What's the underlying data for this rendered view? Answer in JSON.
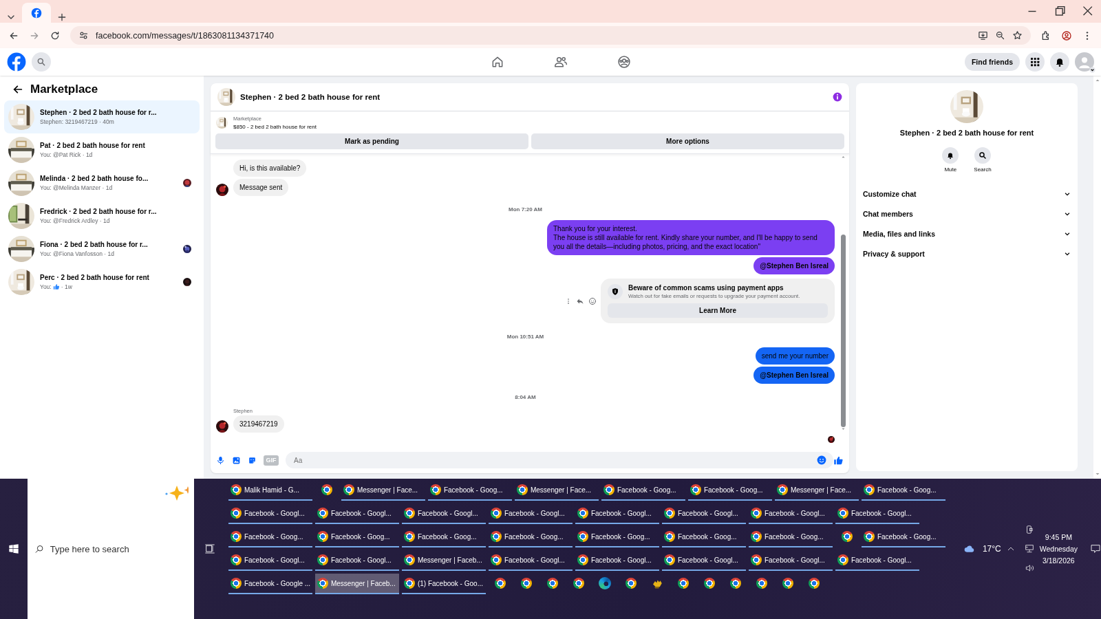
{
  "browser": {
    "url": "facebook.com/messages/t/1863081134371740"
  },
  "header": {
    "find_friends": "Find friends"
  },
  "sidebar": {
    "title": "Marketplace",
    "conversations": [
      {
        "name": "Stephen · 2 bed 2 bath house for r...",
        "preview": "Stephen: 3219467219 · 40m",
        "selected": true,
        "seen_avatar": false,
        "like_icon": false
      },
      {
        "name": "Pat · 2 bed 2 bath house for rent",
        "preview": "You: @Pat Rick · 1d",
        "selected": false,
        "seen_avatar": false,
        "like_icon": false
      },
      {
        "name": "Melinda · 2 bed 2 bath house fo...",
        "preview": "You: @Melinda Manzer · 1d",
        "selected": false,
        "seen_avatar": true,
        "like_icon": false
      },
      {
        "name": "Fredrick · 2 bed 2 bath house for r...",
        "preview": "You: @Fredrick Ardley · 1d",
        "selected": false,
        "seen_avatar": false,
        "like_icon": false
      },
      {
        "name": "Fiona · 2 bed 2 bath house for r...",
        "preview": "You: @Fiona Vanfosson · 1d",
        "selected": false,
        "seen_avatar": true,
        "like_icon": false
      },
      {
        "name": "Perc · 2 bed 2 bath house for rent",
        "preview": "You:",
        "preview_after": "· 1w",
        "selected": false,
        "seen_avatar": true,
        "like_icon": true
      }
    ]
  },
  "chat": {
    "title": "Stephen · 2 bed 2 bath house for rent",
    "listing": {
      "label": "Marketplace",
      "title": "$850 - 2 bed 2 bath house for rent"
    },
    "actions": [
      "Mark as pending",
      "More options"
    ],
    "messages": [
      {
        "kind": "incoming",
        "text": "Hi, is this available?",
        "avatar": false
      },
      {
        "kind": "incoming",
        "text": "Message sent",
        "avatar": true
      },
      {
        "kind": "time",
        "text": "Mon 7:20 AM"
      },
      {
        "kind": "outgoing",
        "text": "Thank you for your interest.\nThe house is still available for rent. Kindly share your number, and I'll be happy to send you all the details—including photos, pricing, and the exact location\"",
        "color": "#7b3ff2",
        "bold": false
      },
      {
        "kind": "outgoing",
        "text": "@Stephen Ben Isreal",
        "color": "#7b3ff2",
        "bold": true
      },
      {
        "kind": "notice",
        "title": "Beware of common scams using payment apps",
        "body": "Watch out for fake emails or requests to upgrade your payment account.",
        "button": "Learn More"
      },
      {
        "kind": "time",
        "text": "Mon 10:51 AM"
      },
      {
        "kind": "outgoing",
        "text": "send me your number",
        "color": "#1465f4",
        "bold": false
      },
      {
        "kind": "outgoing",
        "text": "@Stephen Ben Isreal",
        "color": "#1465f4",
        "bold": true
      },
      {
        "kind": "time",
        "text": "8:04 AM"
      },
      {
        "kind": "incoming",
        "sender": "Stephen",
        "text": "3219467219",
        "avatar": true
      },
      {
        "kind": "seen"
      }
    ],
    "composer": {
      "gif": "GIF",
      "placeholder": "Aa"
    }
  },
  "details": {
    "title": "Stephen · 2 bed 2 bath house for rent",
    "actions": [
      {
        "kind": "mute",
        "label": "Mute"
      },
      {
        "kind": "search",
        "label": "Search"
      }
    ],
    "sections": [
      {
        "label": "Customize chat",
        "expanded": false
      },
      {
        "label": "Chat members",
        "expanded": false
      },
      {
        "label": "Media, files and links",
        "expanded": false
      },
      {
        "label": "Privacy & support",
        "expanded": false
      }
    ]
  },
  "taskbar": {
    "search_placeholder": "Type here to search",
    "windows": [
      {
        "kind": "chrome",
        "label": "Malik Hamid - G...",
        "selected": false
      },
      {
        "kind": "chrome",
        "selected": false
      },
      {
        "kind": "chrome",
        "label": "Messenger | Face...",
        "selected": false
      },
      {
        "kind": "chrome",
        "label": "Facebook - Goog...",
        "selected": false
      },
      {
        "kind": "chrome",
        "label": "Messenger | Face...",
        "selected": false
      },
      {
        "kind": "chrome",
        "label": "Facebook - Goog...",
        "selected": false
      },
      {
        "kind": "chrome",
        "label": "Facebook - Goog...",
        "selected": false
      },
      {
        "kind": "chrome",
        "label": "Messenger | Face...",
        "selected": false
      },
      {
        "kind": "chrome",
        "label": "Facebook - Goog...",
        "selected": false
      },
      {
        "kind": "chrome",
        "label": "Facebook - Googl...",
        "selected": false
      },
      {
        "kind": "chrome",
        "label": "Facebook - Googl...",
        "selected": false
      },
      {
        "kind": "chrome",
        "label": "Facebook - Googl...",
        "selected": false
      },
      {
        "kind": "chrome",
        "label": "Facebook - Googl...",
        "selected": false
      },
      {
        "kind": "chrome",
        "label": "Facebook - Googl...",
        "selected": false
      },
      {
        "kind": "chrome",
        "label": "Facebook - Googl...",
        "selected": false
      },
      {
        "kind": "chrome",
        "label": "Facebook - Googl...",
        "selected": false
      },
      {
        "kind": "chrome",
        "label": "Facebook - Googl...",
        "selected": false
      },
      {
        "kind": "chrome",
        "label": "Facebook - Goog...",
        "selected": false
      },
      {
        "kind": "chrome",
        "label": "Facebook - Goog...",
        "selected": false
      },
      {
        "kind": "chrome",
        "label": "Facebook - Goog...",
        "selected": false
      },
      {
        "kind": "chrome",
        "label": "Facebook - Goog...",
        "selected": false
      },
      {
        "kind": "chrome",
        "label": "Facebook - Goog...",
        "selected": false
      },
      {
        "kind": "chrome",
        "label": "Facebook - Goog...",
        "selected": false
      },
      {
        "kind": "chrome",
        "label": "Facebook - Goog...",
        "selected": false
      },
      {
        "kind": "chrome",
        "selected": false
      },
      {
        "kind": "chrome",
        "label": "Facebook - Goog...",
        "selected": false
      },
      {
        "kind": "chrome",
        "label": "Facebook - Googl...",
        "selected": false
      },
      {
        "kind": "chrome",
        "label": "Facebook - Googl...",
        "selected": false
      },
      {
        "kind": "chrome",
        "label": "Messenger | Faceb...",
        "selected": false
      },
      {
        "kind": "chrome",
        "label": "Facebook - Googl...",
        "selected": false
      },
      {
        "kind": "chrome",
        "label": "Facebook - Googl...",
        "selected": false
      },
      {
        "kind": "chrome",
        "label": "Facebook - Googl...",
        "selected": false
      },
      {
        "kind": "chrome",
        "label": "Facebook - Googl...",
        "selected": false
      },
      {
        "kind": "chrome",
        "label": "Facebook - Googl...",
        "selected": false
      },
      {
        "kind": "chrome",
        "label": "Facebook - Google ...",
        "selected": false
      },
      {
        "kind": "chrome",
        "label": "Messenger | Faceb...",
        "selected": true
      },
      {
        "kind": "chrome",
        "label": "(1) Facebook - Goo...",
        "selected": false
      },
      {
        "kind": "chrome",
        "selected": false
      },
      {
        "kind": "chrome",
        "selected": false
      },
      {
        "kind": "chrome",
        "selected": false
      },
      {
        "kind": "chrome",
        "selected": false
      },
      {
        "kind": "edge",
        "selected": false
      },
      {
        "kind": "chrome",
        "selected": false
      },
      {
        "kind": "hand",
        "selected": false
      },
      {
        "kind": "chrome",
        "selected": false
      },
      {
        "kind": "chrome",
        "selected": false
      },
      {
        "kind": "chrome",
        "selected": false
      },
      {
        "kind": "chrome",
        "selected": false
      },
      {
        "kind": "chrome",
        "selected": false
      },
      {
        "kind": "chrome",
        "selected": false
      }
    ],
    "weather": "17°C",
    "time": "9:45 PM",
    "day": "Wednesday",
    "date": "3/18/2026"
  }
}
